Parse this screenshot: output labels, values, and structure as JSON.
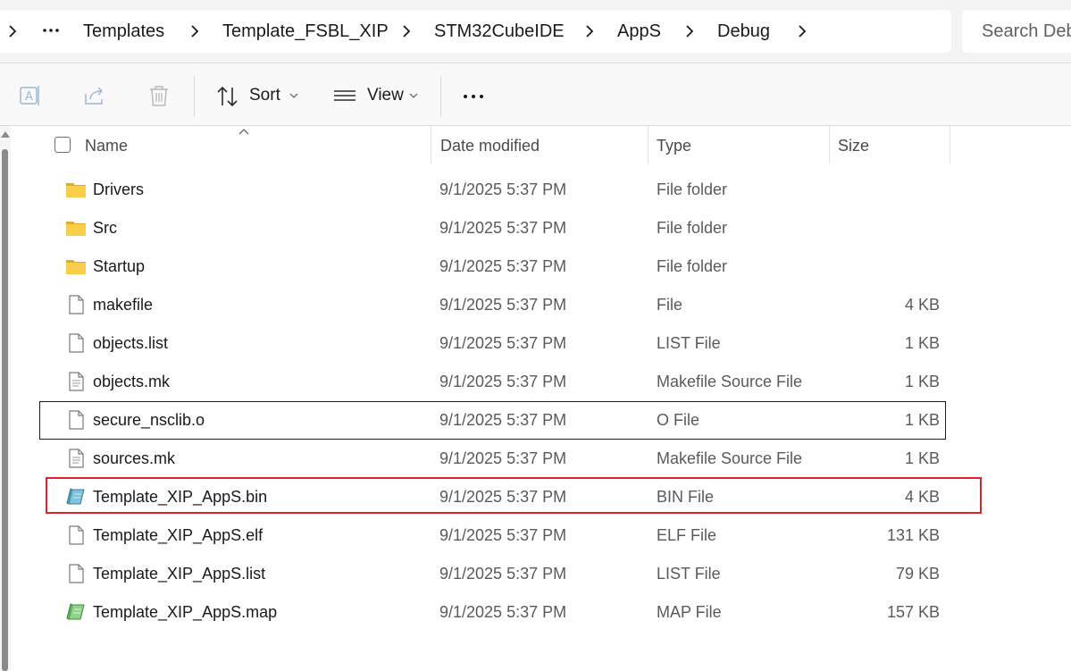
{
  "breadcrumb": {
    "items": [
      "Templates",
      "Template_FSBL_XIP",
      "STM32CubeIDE",
      "AppS",
      "Debug"
    ],
    "overflow_icon": "ellipsis-icon",
    "separator_icon": "chevron-right-icon"
  },
  "search": {
    "placeholder": "Search Debug"
  },
  "toolbar": {
    "rename_icon": "rename-icon",
    "share_icon": "share-icon",
    "delete_icon": "trash-icon",
    "sort_label": "Sort",
    "view_label": "View",
    "more_icon": "more-icon"
  },
  "columns": {
    "name": "Name",
    "date": "Date modified",
    "type": "Type",
    "size": "Size"
  },
  "files": [
    {
      "name": "Drivers",
      "date": "9/1/2025 5:37 PM",
      "type": "File folder",
      "size": "",
      "icon": "folder-icon"
    },
    {
      "name": "Src",
      "date": "9/1/2025 5:37 PM",
      "type": "File folder",
      "size": "",
      "icon": "folder-icon"
    },
    {
      "name": "Startup",
      "date": "9/1/2025 5:37 PM",
      "type": "File folder",
      "size": "",
      "icon": "folder-icon"
    },
    {
      "name": "makefile",
      "date": "9/1/2025 5:37 PM",
      "type": "File",
      "size": "4 KB",
      "icon": "file-icon"
    },
    {
      "name": "objects.list",
      "date": "9/1/2025 5:37 PM",
      "type": "LIST File",
      "size": "1 KB",
      "icon": "file-icon"
    },
    {
      "name": "objects.mk",
      "date": "9/1/2025 5:37 PM",
      "type": "Makefile Source File",
      "size": "1 KB",
      "icon": "text-file-icon"
    },
    {
      "name": "secure_nsclib.o",
      "date": "9/1/2025 5:37 PM",
      "type": "O File",
      "size": "1 KB",
      "icon": "file-icon",
      "focused": true
    },
    {
      "name": "sources.mk",
      "date": "9/1/2025 5:37 PM",
      "type": "Makefile Source File",
      "size": "1 KB",
      "icon": "text-file-icon"
    },
    {
      "name": "Template_XIP_AppS.bin",
      "date": "9/1/2025 5:37 PM",
      "type": "BIN File",
      "size": "4 KB",
      "icon": "bin-file-icon",
      "highlighted": true
    },
    {
      "name": "Template_XIP_AppS.elf",
      "date": "9/1/2025 5:37 PM",
      "type": "ELF File",
      "size": "131 KB",
      "icon": "file-icon"
    },
    {
      "name": "Template_XIP_AppS.list",
      "date": "9/1/2025 5:37 PM",
      "type": "LIST File",
      "size": "79 KB",
      "icon": "file-icon"
    },
    {
      "name": "Template_XIP_AppS.map",
      "date": "9/1/2025 5:37 PM",
      "type": "MAP File",
      "size": "157 KB",
      "icon": "map-file-icon"
    }
  ],
  "colors": {
    "highlight": "#e0202a",
    "folder": "#f4c542"
  }
}
